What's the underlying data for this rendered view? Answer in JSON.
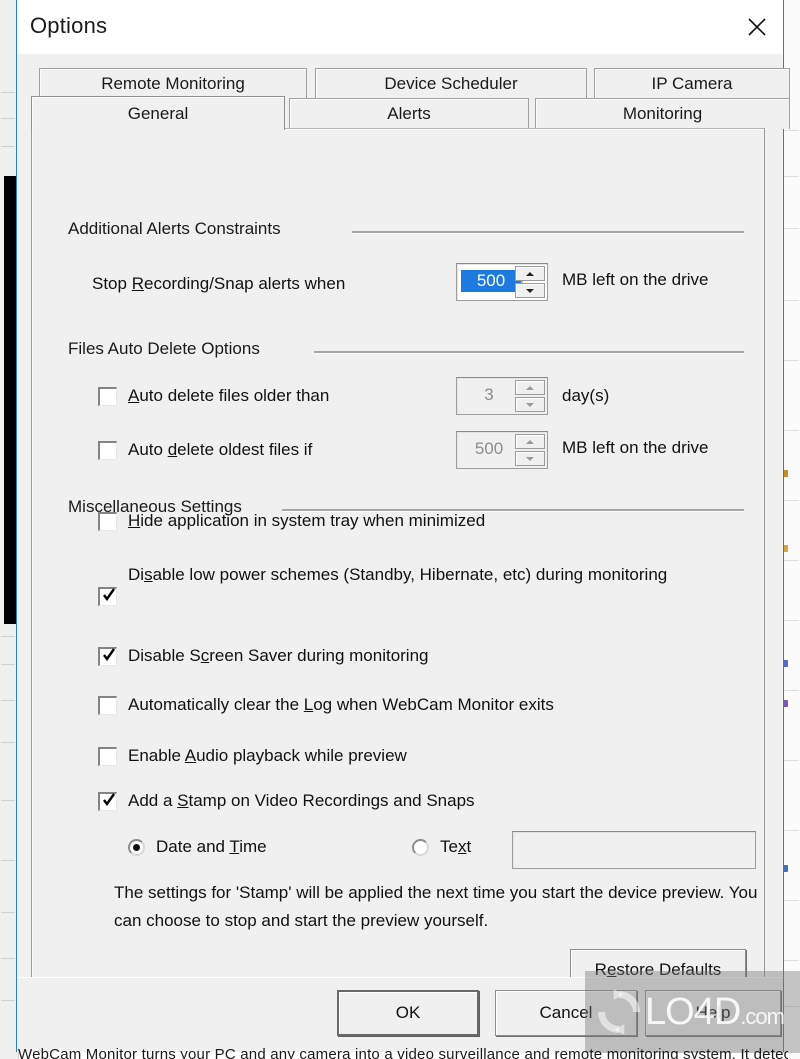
{
  "window": {
    "title": "Options",
    "close_icon": "close-icon"
  },
  "tabs": {
    "row1": [
      {
        "label": "Remote Monitoring",
        "selected": false
      },
      {
        "label": "Device Scheduler",
        "selected": false
      },
      {
        "label": "IP Camera",
        "selected": false
      }
    ],
    "row2": [
      {
        "label": "General",
        "selected": true
      },
      {
        "label": "Alerts",
        "selected": false
      },
      {
        "label": "Monitoring",
        "selected": false
      }
    ]
  },
  "groups": {
    "alerts_constraints": "Additional Alerts Constraints",
    "auto_delete": "Files Auto Delete Options",
    "misc": "Miscellaneous Settings"
  },
  "alerts_constraints": {
    "stop_recording_label": "Stop Recording/Snap alerts when",
    "stop_recording_accel": "R",
    "stop_recording_value": "500",
    "stop_recording_unit": "MB left on the drive"
  },
  "auto_delete": {
    "older_than_label": "Auto delete files older than",
    "older_than_accel": "A",
    "older_than_checked": false,
    "older_than_value": "3",
    "older_than_unit": "day(s)",
    "oldest_files_label": "Auto delete oldest files if",
    "oldest_files_accel": "d",
    "oldest_files_checked": false,
    "oldest_files_value": "500",
    "oldest_files_unit": "MB left on the drive"
  },
  "misc": {
    "items": [
      {
        "label": "Hide application in system tray when minimized",
        "accel": "H",
        "checked": false
      },
      {
        "label": "Disable low power schemes (Standby, Hibernate, etc) during monitoring",
        "accel": "s",
        "checked": true
      },
      {
        "label": "Disable Screen Saver during monitoring",
        "accel": "c",
        "checked": true
      },
      {
        "label": "Automatically clear the Log when WebCam Monitor exits",
        "accel": "L",
        "checked": false
      },
      {
        "label": "Enable Audio playback while preview",
        "accel": "A",
        "checked": false
      },
      {
        "label": "Add a Stamp on Video Recordings and Snaps",
        "accel": "S",
        "checked": true
      }
    ]
  },
  "stamp": {
    "radio_date_time": "Date and Time",
    "radio_date_time_accel": "T",
    "radio_date_time_selected": true,
    "radio_text": "Text",
    "radio_text_accel": "x",
    "radio_text_selected": false,
    "text_value": "",
    "note": "The settings for 'Stamp' will be applied the next time you start the device preview. You can choose to stop and start the preview yourself."
  },
  "buttons": {
    "restore_defaults": "Restore Defaults",
    "restore_defaults_accel": "e",
    "ok": "OK",
    "cancel": "Cancel",
    "help": "Help"
  },
  "watermark": {
    "text": "LO4D",
    "suffix": ".com"
  },
  "background": {
    "bottom_text": "WebCam Monitor turns your PC and any camera into a video surveillance and remote monitoring system. It detects"
  },
  "colors": {
    "window_border": "#2a7fd4",
    "dialog_face": "#f0f0f0",
    "selection": "#1f7ae0",
    "caret": "#ffb060"
  }
}
